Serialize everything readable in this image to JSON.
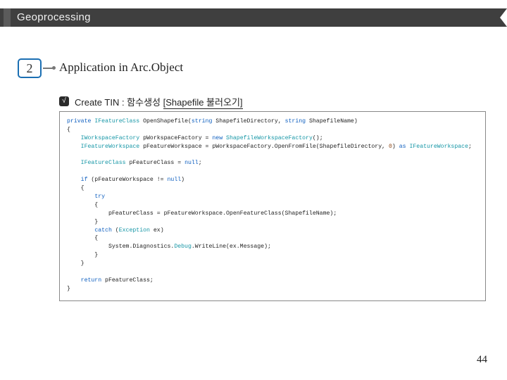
{
  "header": {
    "title": "Geoprocessing"
  },
  "section": {
    "number": "2",
    "title": "Application in Arc.Object"
  },
  "bullet_glyph": "√",
  "subtitle": {
    "lead": "Create TIN : 함수생성 ",
    "underlined": "[Shapefile 불러오기]"
  },
  "code_html": "<span class='kw'>private</span> <span class='tp'>IFeatureClass</span> OpenShapefile(<span class='kw'>string</span> ShapefileDirectory, <span class='kw'>string</span> ShapefileName)\n{\n    <span class='tp'>IWorkspaceFactory</span> pWorkspaceFactory = <span class='kw'>new</span> <span class='tp'>ShapefileWorkspaceFactory</span>();\n    <span class='tp'>IFeatureWorkspace</span> pFeatureWorkspace = pWorkspaceFactory.OpenFromFile(ShapefileDirectory, <span class='num'>0</span>) <span class='kw'>as</span> <span class='tp'>IFeatureWorkspace</span>;\n\n    <span class='tp'>IFeatureClass</span> pFeatureClass = <span class='kw'>null</span>;\n\n    <span class='kw'>if</span> (pFeatureWorkspace != <span class='kw'>null</span>)\n    {\n        <span class='kw'>try</span>\n        {\n            pFeatureClass = pFeatureWorkspace.OpenFeatureClass(ShapefileName);\n        }\n        <span class='kw'>catch</span> (<span class='tp'>Exception</span> ex)\n        {\n            System.Diagnostics.<span class='tp'>Debug</span>.WriteLine(ex.Message);\n        }\n    }\n\n    <span class='kw'>return</span> pFeatureClass;\n}",
  "page_number": "44"
}
